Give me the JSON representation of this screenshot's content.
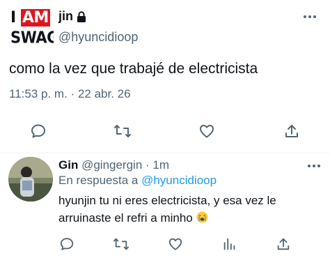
{
  "main_tweet": {
    "avatar": {
      "line1_a": "I",
      "line1_b": "AM",
      "line2": "SWAG"
    },
    "author_name": "jin",
    "author_handle": "@hyuncidioop",
    "text": "como la vez que trabajé de electricista",
    "time": "11:53 p. m.",
    "separator": "·",
    "date": "22 abr. 26",
    "icons": [
      "reply-icon",
      "retweet-icon",
      "like-icon",
      "share-icon",
      "more-icon",
      "lock-icon"
    ]
  },
  "reply": {
    "author_name": "Gin",
    "author_handle": "@gingergin",
    "separator": "·",
    "age": "1m",
    "reply_prefix": "En respuesta a",
    "reply_mention": "@hyuncidioop",
    "text": "hyunjin tu ni eres electricista, y esa vez le arruinaste el refri a minho",
    "emoji": "loudly-crying-face",
    "icons": [
      "reply-icon",
      "retweet-icon",
      "like-icon",
      "views-icon",
      "share-icon",
      "more-icon"
    ]
  },
  "colors": {
    "text_primary": "#0f1419",
    "text_secondary": "#536471",
    "link": "#1d9bf0",
    "divider": "#eff3f4",
    "swag_red": "#e0141e"
  }
}
